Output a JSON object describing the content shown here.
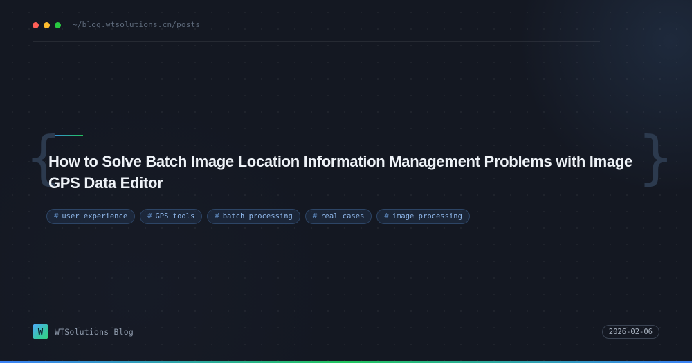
{
  "window": {
    "path": "~/blog.wtsolutions.cn/posts",
    "controls": [
      "close",
      "minimize",
      "maximize"
    ]
  },
  "post": {
    "title": "How to Solve Batch Image Location Information Management Problems with Image GPS Data Editor",
    "tags": [
      {
        "hash": "#",
        "label": "user experience"
      },
      {
        "hash": "#",
        "label": "GPS tools"
      },
      {
        "hash": "#",
        "label": "batch processing"
      },
      {
        "hash": "#",
        "label": "real cases"
      },
      {
        "hash": "#",
        "label": "image processing"
      }
    ],
    "brace_open": "{",
    "brace_close": "}"
  },
  "footer": {
    "logo_letter": "W",
    "brand_name": "WTSolutions Blog",
    "date": "2026-02-06"
  },
  "colors": {
    "background": "#141822",
    "accent_blue": "#3b82f6",
    "accent_green": "#22c55e",
    "tag_text": "#8fb7ea",
    "close": "#ff5f57",
    "minimize": "#febc2e",
    "maximize": "#28c840"
  }
}
